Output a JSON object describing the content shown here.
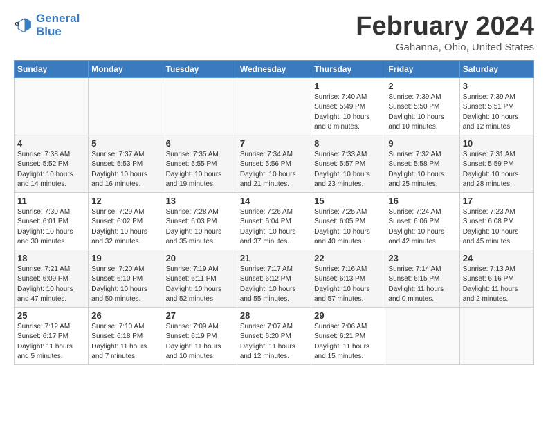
{
  "logo": {
    "line1": "General",
    "line2": "Blue"
  },
  "title": "February 2024",
  "subtitle": "Gahanna, Ohio, United States",
  "days_of_week": [
    "Sunday",
    "Monday",
    "Tuesday",
    "Wednesday",
    "Thursday",
    "Friday",
    "Saturday"
  ],
  "weeks": [
    [
      {
        "num": "",
        "info": ""
      },
      {
        "num": "",
        "info": ""
      },
      {
        "num": "",
        "info": ""
      },
      {
        "num": "",
        "info": ""
      },
      {
        "num": "1",
        "info": "Sunrise: 7:40 AM\nSunset: 5:49 PM\nDaylight: 10 hours\nand 8 minutes."
      },
      {
        "num": "2",
        "info": "Sunrise: 7:39 AM\nSunset: 5:50 PM\nDaylight: 10 hours\nand 10 minutes."
      },
      {
        "num": "3",
        "info": "Sunrise: 7:39 AM\nSunset: 5:51 PM\nDaylight: 10 hours\nand 12 minutes."
      }
    ],
    [
      {
        "num": "4",
        "info": "Sunrise: 7:38 AM\nSunset: 5:52 PM\nDaylight: 10 hours\nand 14 minutes."
      },
      {
        "num": "5",
        "info": "Sunrise: 7:37 AM\nSunset: 5:53 PM\nDaylight: 10 hours\nand 16 minutes."
      },
      {
        "num": "6",
        "info": "Sunrise: 7:35 AM\nSunset: 5:55 PM\nDaylight: 10 hours\nand 19 minutes."
      },
      {
        "num": "7",
        "info": "Sunrise: 7:34 AM\nSunset: 5:56 PM\nDaylight: 10 hours\nand 21 minutes."
      },
      {
        "num": "8",
        "info": "Sunrise: 7:33 AM\nSunset: 5:57 PM\nDaylight: 10 hours\nand 23 minutes."
      },
      {
        "num": "9",
        "info": "Sunrise: 7:32 AM\nSunset: 5:58 PM\nDaylight: 10 hours\nand 25 minutes."
      },
      {
        "num": "10",
        "info": "Sunrise: 7:31 AM\nSunset: 5:59 PM\nDaylight: 10 hours\nand 28 minutes."
      }
    ],
    [
      {
        "num": "11",
        "info": "Sunrise: 7:30 AM\nSunset: 6:01 PM\nDaylight: 10 hours\nand 30 minutes."
      },
      {
        "num": "12",
        "info": "Sunrise: 7:29 AM\nSunset: 6:02 PM\nDaylight: 10 hours\nand 32 minutes."
      },
      {
        "num": "13",
        "info": "Sunrise: 7:28 AM\nSunset: 6:03 PM\nDaylight: 10 hours\nand 35 minutes."
      },
      {
        "num": "14",
        "info": "Sunrise: 7:26 AM\nSunset: 6:04 PM\nDaylight: 10 hours\nand 37 minutes."
      },
      {
        "num": "15",
        "info": "Sunrise: 7:25 AM\nSunset: 6:05 PM\nDaylight: 10 hours\nand 40 minutes."
      },
      {
        "num": "16",
        "info": "Sunrise: 7:24 AM\nSunset: 6:06 PM\nDaylight: 10 hours\nand 42 minutes."
      },
      {
        "num": "17",
        "info": "Sunrise: 7:23 AM\nSunset: 6:08 PM\nDaylight: 10 hours\nand 45 minutes."
      }
    ],
    [
      {
        "num": "18",
        "info": "Sunrise: 7:21 AM\nSunset: 6:09 PM\nDaylight: 10 hours\nand 47 minutes."
      },
      {
        "num": "19",
        "info": "Sunrise: 7:20 AM\nSunset: 6:10 PM\nDaylight: 10 hours\nand 50 minutes."
      },
      {
        "num": "20",
        "info": "Sunrise: 7:19 AM\nSunset: 6:11 PM\nDaylight: 10 hours\nand 52 minutes."
      },
      {
        "num": "21",
        "info": "Sunrise: 7:17 AM\nSunset: 6:12 PM\nDaylight: 10 hours\nand 55 minutes."
      },
      {
        "num": "22",
        "info": "Sunrise: 7:16 AM\nSunset: 6:13 PM\nDaylight: 10 hours\nand 57 minutes."
      },
      {
        "num": "23",
        "info": "Sunrise: 7:14 AM\nSunset: 6:15 PM\nDaylight: 11 hours\nand 0 minutes."
      },
      {
        "num": "24",
        "info": "Sunrise: 7:13 AM\nSunset: 6:16 PM\nDaylight: 11 hours\nand 2 minutes."
      }
    ],
    [
      {
        "num": "25",
        "info": "Sunrise: 7:12 AM\nSunset: 6:17 PM\nDaylight: 11 hours\nand 5 minutes."
      },
      {
        "num": "26",
        "info": "Sunrise: 7:10 AM\nSunset: 6:18 PM\nDaylight: 11 hours\nand 7 minutes."
      },
      {
        "num": "27",
        "info": "Sunrise: 7:09 AM\nSunset: 6:19 PM\nDaylight: 11 hours\nand 10 minutes."
      },
      {
        "num": "28",
        "info": "Sunrise: 7:07 AM\nSunset: 6:20 PM\nDaylight: 11 hours\nand 12 minutes."
      },
      {
        "num": "29",
        "info": "Sunrise: 7:06 AM\nSunset: 6:21 PM\nDaylight: 11 hours\nand 15 minutes."
      },
      {
        "num": "",
        "info": ""
      },
      {
        "num": "",
        "info": ""
      }
    ]
  ]
}
